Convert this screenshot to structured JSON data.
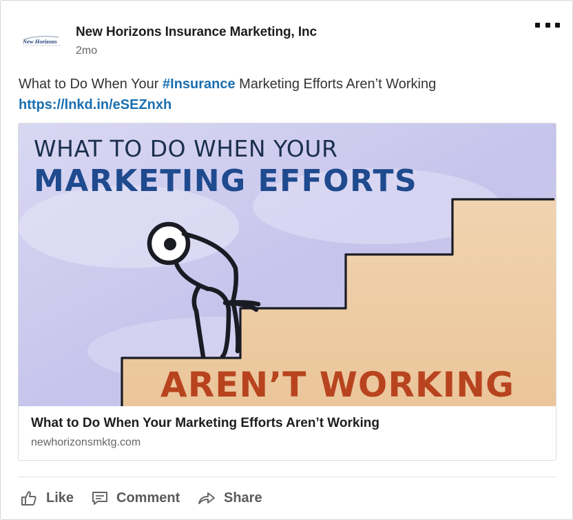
{
  "author": {
    "name": "New Horizons Insurance Marketing, Inc",
    "time": "2mo",
    "logo_text": "New Horizons"
  },
  "post": {
    "text_before": "What to Do When Your ",
    "hashtag": "#Insurance",
    "text_after": " Marketing Efforts Aren’t Working",
    "link": "https://lnkd.in/eSEZnxh"
  },
  "preview": {
    "image_line1": "WHAT TO DO WHEN YOUR",
    "image_line2": "MARKETING EFFORTS",
    "image_line3": "AREN’T WORKING",
    "title": "What to Do When Your Marketing Efforts Aren’t Working",
    "domain": "newhorizonsmktg.com"
  },
  "actions": {
    "like": "Like",
    "comment": "Comment",
    "share": "Share"
  },
  "icons": {
    "more": "more-options-icon",
    "like": "thumbs-up-icon",
    "comment": "comment-icon",
    "share": "share-arrow-icon"
  },
  "colors": {
    "link": "#1a6fb0",
    "image_title_dark": "#1c2f4f",
    "image_title_blue": "#1f4a8e",
    "image_title_red": "#b8441f"
  }
}
